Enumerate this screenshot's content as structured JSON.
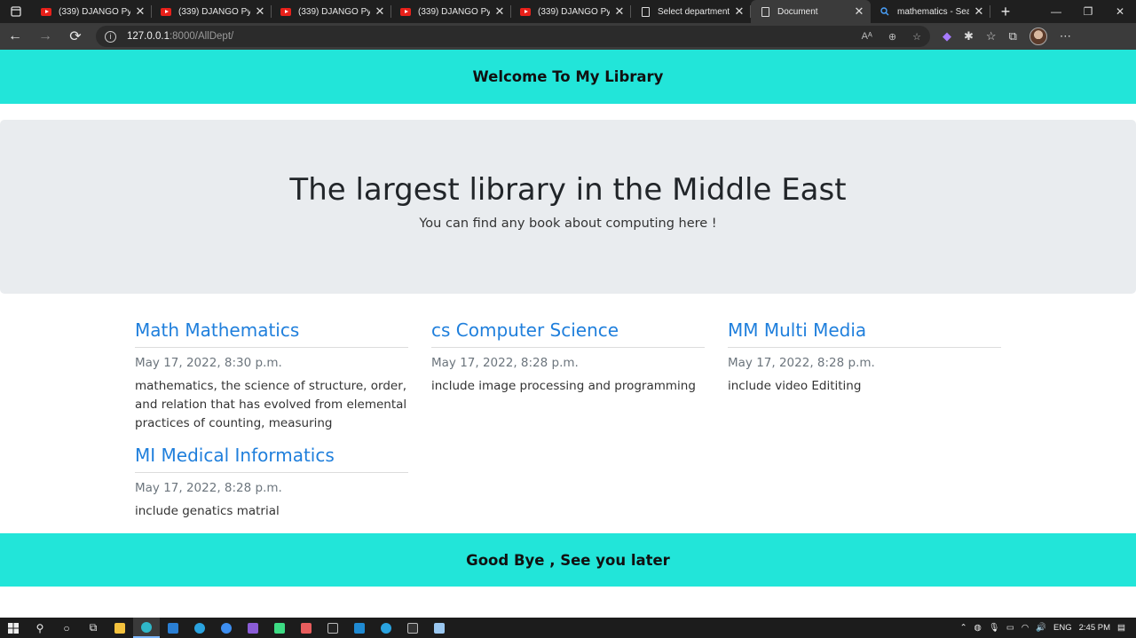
{
  "browser": {
    "tabs": [
      {
        "title": "(339) DJANGO Pyth",
        "icon": "youtube-icon"
      },
      {
        "title": "(339) DJANGO Pyth",
        "icon": "youtube-icon"
      },
      {
        "title": "(339) DJANGO Pyth",
        "icon": "youtube-icon"
      },
      {
        "title": "(339) DJANGO Pyth",
        "icon": "youtube-icon"
      },
      {
        "title": "(339) DJANGO Pyth",
        "icon": "youtube-icon"
      },
      {
        "title": "Select department",
        "icon": "document-icon"
      },
      {
        "title": "Document",
        "icon": "document-icon",
        "active": true
      },
      {
        "title": "mathematics - Sea",
        "icon": "search-icon"
      }
    ],
    "url_host": "127.0.0.1",
    "url_path": ":8000/AllDept/"
  },
  "page": {
    "header": "Welcome To My Library",
    "jumbotron": {
      "title": "The largest library in the Middle East",
      "subtitle": "You can find any book about computing here !"
    },
    "departments": [
      {
        "title": "Math Mathematics",
        "date": "May 17, 2022, 8:30 p.m.",
        "description": "mathematics, the science of structure, order, and relation that has evolved from elemental practices of counting, measuring"
      },
      {
        "title": "cs Computer Science",
        "date": "May 17, 2022, 8:28 p.m.",
        "description": "include image processing and programming"
      },
      {
        "title": "MM Multi Media",
        "date": "May 17, 2022, 8:28 p.m.",
        "description": "include video Edititing"
      },
      {
        "title": "MI Medical Informatics",
        "date": "May 17, 2022, 8:28 p.m.",
        "description": "include genatics matrial"
      }
    ],
    "footer": "Good Bye , See you later"
  },
  "taskbar": {
    "language": "ENG",
    "time": "2:45 PM"
  },
  "colors": {
    "banner": "#22e5d9",
    "jumbotron": "#e9ecef",
    "link": "#1f7fdc"
  }
}
